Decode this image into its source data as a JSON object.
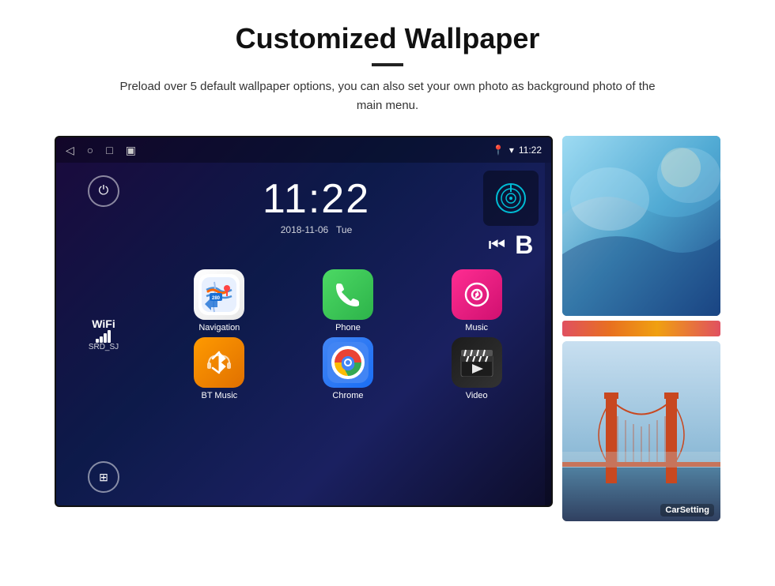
{
  "header": {
    "title": "Customized Wallpaper",
    "subtitle": "Preload over 5 default wallpaper options, you can also set your own photo as background photo of the main menu."
  },
  "screen": {
    "time": "11:22",
    "date": "2018-11-06",
    "day": "Tue",
    "wifi_name": "WiFi",
    "wifi_ssid": "SRD_SJ",
    "status_time": "11:22"
  },
  "apps": [
    {
      "id": "navigation",
      "label": "Navigation",
      "icon_type": "navigation"
    },
    {
      "id": "phone",
      "label": "Phone",
      "icon_type": "phone"
    },
    {
      "id": "music",
      "label": "Music",
      "icon_type": "music"
    },
    {
      "id": "btmusic",
      "label": "BT Music",
      "icon_type": "btmusic"
    },
    {
      "id": "chrome",
      "label": "Chrome",
      "icon_type": "chrome"
    },
    {
      "id": "video",
      "label": "Video",
      "icon_type": "video"
    }
  ],
  "wallpapers": [
    {
      "id": "glacier",
      "label": "glacier"
    },
    {
      "id": "bridge",
      "label": "CarSetting"
    }
  ]
}
